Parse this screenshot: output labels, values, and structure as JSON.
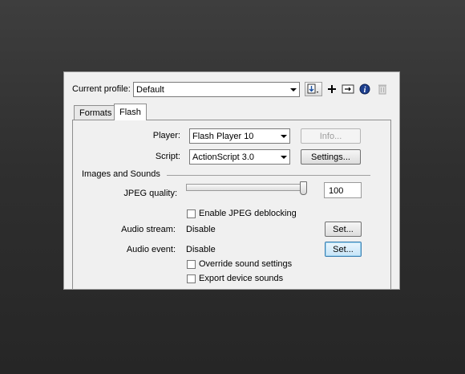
{
  "profile": {
    "label": "Current profile:",
    "value": "Default"
  },
  "toolbar": {
    "import_export_icon": "import-export-icon",
    "add_icon": "plus-icon",
    "duplicate_icon": "duplicate-icon",
    "info_icon": "info-icon",
    "delete_icon": "trash-icon"
  },
  "tabs": [
    {
      "label": "Formats"
    },
    {
      "label": "Flash"
    }
  ],
  "flash": {
    "player_label": "Player:",
    "player_value": "Flash Player 10",
    "info_button": "Info...",
    "script_label": "Script:",
    "script_value": "ActionScript 3.0",
    "settings_button": "Settings...",
    "images_sounds_heading": "Images and Sounds",
    "jpeg_quality_label": "JPEG quality:",
    "jpeg_quality_value": "100",
    "jpeg_quality_fraction": 1.0,
    "jpeg_deblocking_label": "Enable JPEG deblocking",
    "jpeg_deblocking_checked": false,
    "audio_stream_label": "Audio stream:",
    "audio_stream_value": "Disable",
    "audio_stream_button": "Set...",
    "audio_event_label": "Audio event:",
    "audio_event_value": "Disable",
    "audio_event_button": "Set...",
    "override_sound_label": "Override sound settings",
    "override_sound_checked": false,
    "export_device_label": "Export device sounds",
    "export_device_checked": false
  },
  "colors": {
    "focus_border": "#3c7fb1",
    "disabled_text": "#9c9c9c"
  }
}
